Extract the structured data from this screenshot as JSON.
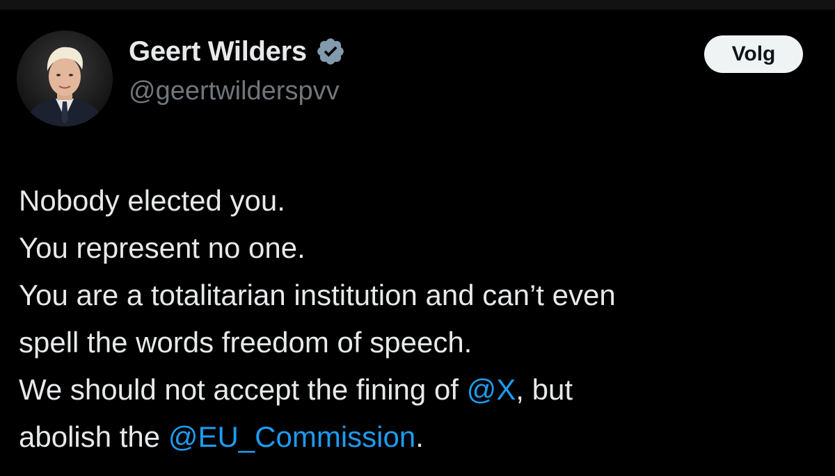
{
  "tweet": {
    "author": {
      "display_name": "Geert Wilders",
      "handle": "@geertwilderspvv",
      "verified": true,
      "avatar_icon": "profile-photo"
    },
    "follow_button_label": "Volg",
    "text_lines": [
      {
        "text": "Nobody elected you."
      },
      {
        "text": "You represent no one."
      },
      {
        "text": "You are a totalitarian institution and can’t even"
      },
      {
        "text": "spell the words freedom of speech."
      },
      {
        "before": "We should not accept the fining of ",
        "mention": "@X",
        "after": ", but"
      },
      {
        "before": "abolish the ",
        "mention": "@EU_Commission",
        "after": "."
      }
    ]
  },
  "colors": {
    "background": "#000000",
    "text": "#e7e9ea",
    "secondary_text": "#71767b",
    "mention": "#1d9bf0",
    "verified_badge": "#829aab",
    "button_bg": "#eff3f4",
    "button_text": "#0f1419"
  }
}
